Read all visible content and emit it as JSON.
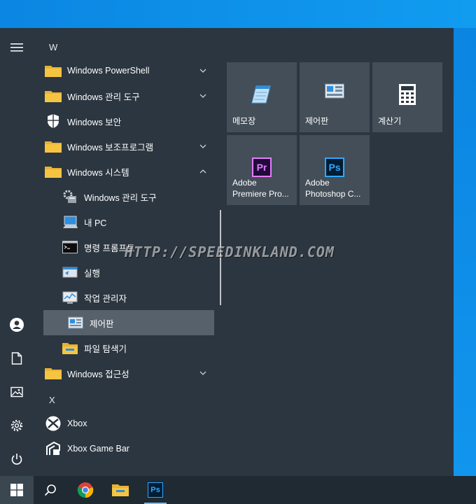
{
  "watermark": "HTTP://SPEEDINKLAND.COM",
  "applist": {
    "letters": {
      "w": "W",
      "x": "X"
    },
    "items": [
      {
        "label": "Windows PowerShell",
        "icon": "folder-icon"
      },
      {
        "label": "Windows 관리 도구",
        "icon": "folder-icon"
      },
      {
        "label": "Windows 보안",
        "icon": "shield-icon"
      },
      {
        "label": "Windows 보조프로그램",
        "icon": "folder-icon"
      },
      {
        "label": "Windows 시스템",
        "icon": "folder-icon"
      },
      {
        "label": "Windows 관리 도구",
        "icon": "admin-tools-icon"
      },
      {
        "label": "내 PC",
        "icon": "this-pc-icon"
      },
      {
        "label": "명령 프롬프트",
        "icon": "cmd-icon"
      },
      {
        "label": "실행",
        "icon": "run-icon"
      },
      {
        "label": "작업 관리자",
        "icon": "task-manager-icon"
      },
      {
        "label": "제어판",
        "icon": "control-panel-icon"
      },
      {
        "label": "파일 탐색기",
        "icon": "file-explorer-icon"
      },
      {
        "label": "Windows 접근성",
        "icon": "folder-icon"
      },
      {
        "label": "Xbox",
        "icon": "xbox-icon"
      },
      {
        "label": "Xbox Game Bar",
        "icon": "xbox-game-bar-icon"
      }
    ]
  },
  "tiles": [
    {
      "label": "메모장",
      "icon": "notepad-icon"
    },
    {
      "label": "제어판",
      "icon": "control-panel-icon"
    },
    {
      "label": "계산기",
      "icon": "calculator-icon"
    },
    {
      "label": "Adobe\nPremiere Pro...",
      "icon": "premiere-pro-icon",
      "glyph": "Pr"
    },
    {
      "label": "Adobe\nPhotoshop C...",
      "icon": "photoshop-icon",
      "glyph": "Ps"
    }
  ],
  "taskbar": {
    "ps_glyph": "Ps",
    "items": [
      "start-button",
      "search-button",
      "chrome",
      "file-explorer",
      "photoshop"
    ]
  },
  "colors": {
    "menu_bg": "#2b3640",
    "tile_bg": "#434e58",
    "folder": "#f5c542",
    "accent": "#0a84e0"
  }
}
